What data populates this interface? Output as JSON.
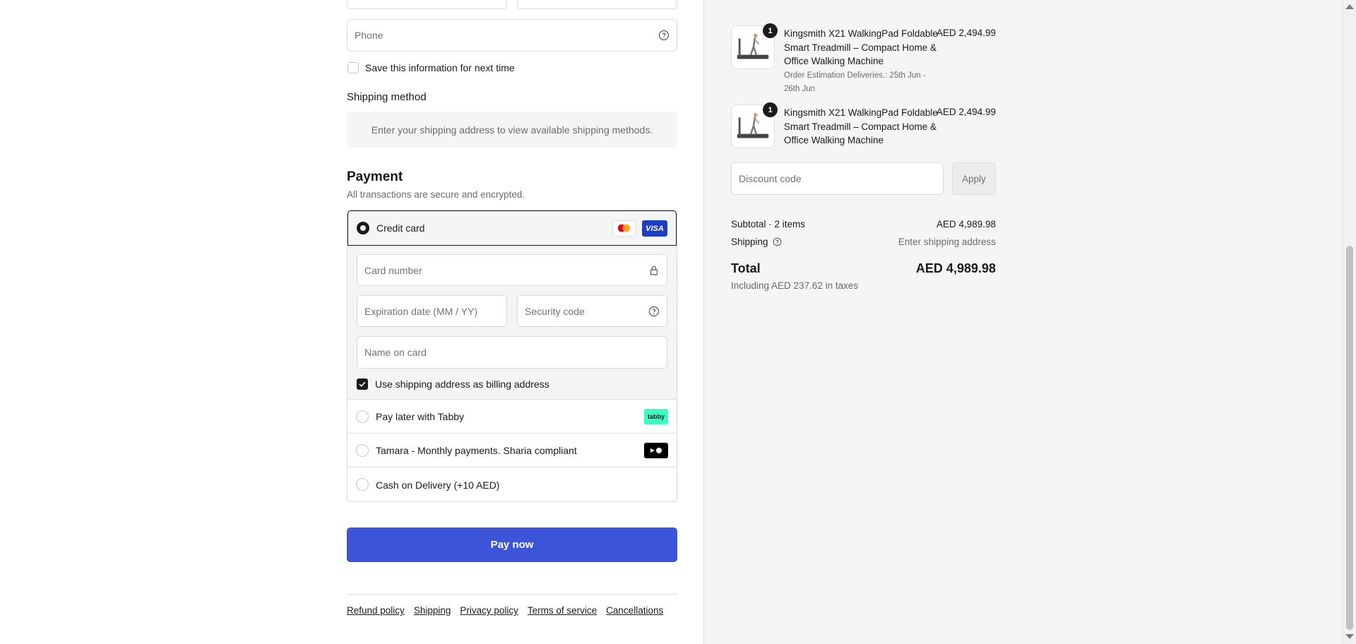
{
  "form": {
    "phone_placeholder": "Phone",
    "save_info_label": "Save this information for next time"
  },
  "shipping_method": {
    "heading": "Shipping method",
    "message": "Enter your shipping address to view available shipping methods."
  },
  "payment": {
    "heading": "Payment",
    "subheading": "All transactions are secure and encrypted.",
    "credit_card_label": "Credit card",
    "card_brands": [
      "mastercard",
      "VISA"
    ],
    "card_number_placeholder": "Card number",
    "expiration_placeholder": "Expiration date (MM / YY)",
    "security_code_placeholder": "Security code",
    "name_on_card_placeholder": "Name on card",
    "billing_same_label": "Use shipping address as billing address",
    "options": [
      {
        "label": "Pay later with Tabby",
        "badge": "tabby"
      },
      {
        "label": "Tamara - Monthly payments. Sharia compliant",
        "badge": "tamara"
      },
      {
        "label": "Cash on Delivery (+10 AED)"
      }
    ]
  },
  "pay_button": "Pay now",
  "footer_links": [
    "Refund policy",
    "Shipping",
    "Privacy policy",
    "Terms of service",
    "Cancellations"
  ],
  "order": {
    "items": [
      {
        "qty": "1",
        "title": "Kingsmith X21 WalkingPad Foldable Smart Treadmill – Compact Home & Office Walking Machine",
        "note": "Order Estimation Deliveries.: 25th Jun - 26th Jun",
        "price": "AED 2,494.99"
      },
      {
        "qty": "1",
        "title": "Kingsmith X21 WalkingPad Foldable Smart Treadmill – Compact Home & Office Walking Machine",
        "price": "AED 2,494.99"
      }
    ],
    "discount_placeholder": "Discount code",
    "apply_label": "Apply",
    "subtotal_label": "Subtotal · 2 items",
    "subtotal_value": "AED 4,989.98",
    "shipping_label": "Shipping",
    "shipping_value": "Enter shipping address",
    "total_label": "Total",
    "total_value": "AED 4,989.98",
    "tax_note": "Including AED 237.62 in taxes"
  },
  "colors": {
    "pay_button": "#3c55d8",
    "visa": "#1a3fc4",
    "tabby": "#3bffc1",
    "tamara": "#000000"
  }
}
